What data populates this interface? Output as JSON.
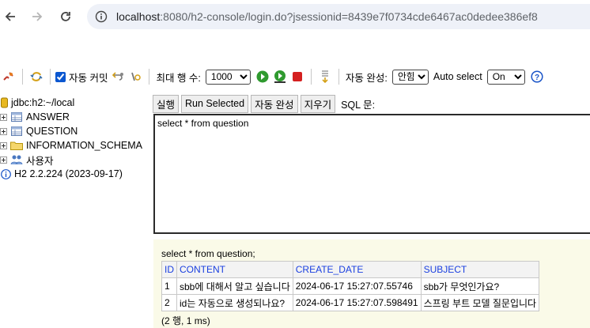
{
  "browser": {
    "url_host": "localhost",
    "url_rest": ":8080/h2-console/login.do?jsessionid=8439e7f0734cde6467ac0dedee386ef8"
  },
  "toolbar": {
    "auto_commit_label": "자동 커밋",
    "auto_commit_checked": true,
    "max_rows_label": "최대 행 수:",
    "max_rows_value": "1000",
    "auto_complete_label": "자동 완성:",
    "auto_complete_value": "안함",
    "auto_select_label": "Auto select",
    "auto_select_value": "On"
  },
  "tree": {
    "connection": "jdbc:h2:~/local",
    "items": [
      {
        "label": "ANSWER",
        "icon": "table-icon"
      },
      {
        "label": "QUESTION",
        "icon": "table-icon"
      },
      {
        "label": "INFORMATION_SCHEMA",
        "icon": "folder-icon"
      },
      {
        "label": "사용자",
        "icon": "users-icon"
      }
    ],
    "version": "H2 2.2.224 (2023-09-17)"
  },
  "query": {
    "run_label": "실행",
    "run_selected_label": "Run Selected",
    "auto_complete_label": "자동 완성",
    "clear_label": "지우기",
    "sql_label": "SQL 문:",
    "sql_text": "select * from question"
  },
  "result": {
    "statement": "select * from question;",
    "columns": [
      "ID",
      "CONTENT",
      "CREATE_DATE",
      "SUBJECT"
    ],
    "rows": [
      [
        "1",
        "sbb에 대해서 알고 싶습니다",
        "2024-06-17 15:27:07.55746",
        "sbb가 무엇인가요?"
      ],
      [
        "2",
        "id는 자동으로 생성되나요?",
        "2024-06-17 15:27:07.598491",
        "스프링 부트 모델 질문입니다"
      ]
    ],
    "summary": "(2 행, 1 ms)"
  },
  "colors": {
    "header_link": "#1a3fe0",
    "result_bg": "#fafae8",
    "run_green": "#2f9a2f",
    "stop_red": "#d42020"
  }
}
